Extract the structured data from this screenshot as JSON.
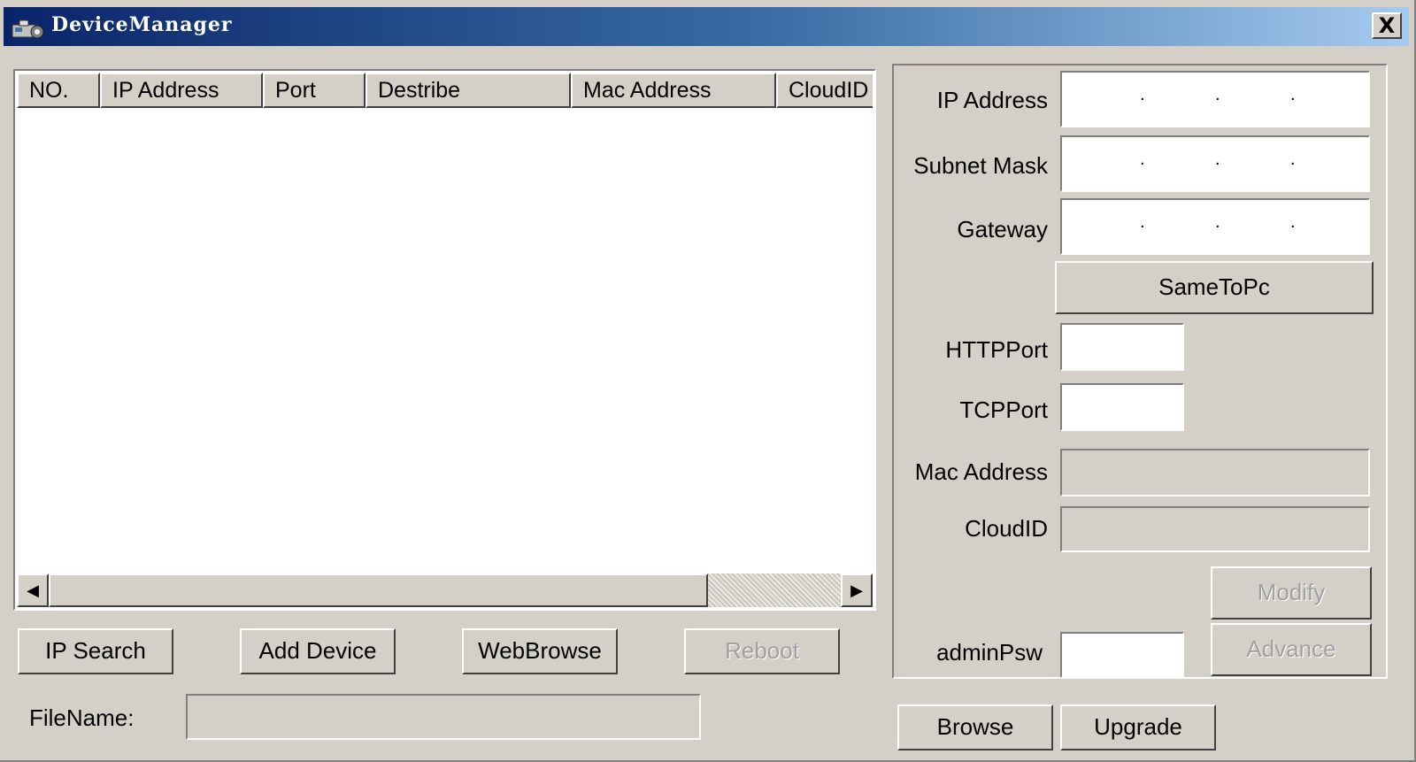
{
  "window": {
    "title": "DeviceManager",
    "close_glyph": "X",
    "app_icon": "device-manager-icon"
  },
  "list": {
    "columns": [
      "NO.",
      "IP Address",
      "Port",
      "Destribe",
      "Mac Address",
      "CloudID"
    ],
    "rows": []
  },
  "scrollbar": {
    "left_glyph": "◀",
    "right_glyph": "▶"
  },
  "actions": {
    "ip_search": "IP Search",
    "add_device": "Add Device",
    "web_browse": "WebBrowse",
    "reboot": "Reboot"
  },
  "file": {
    "label": "FileName:",
    "value": ""
  },
  "panel": {
    "ip_address_label": "IP Address",
    "ip_address_value": "",
    "subnet_mask_label": "Subnet Mask",
    "subnet_mask_value": "",
    "gateway_label": "Gateway",
    "gateway_value": "",
    "ip_separator": ".",
    "same_to_pc": "SameToPc",
    "http_port_label": "HTTPPort",
    "http_port_value": "",
    "tcp_port_label": "TCPPort",
    "tcp_port_value": "",
    "mac_address_label": "Mac Address",
    "mac_address_value": "",
    "cloud_id_label": "CloudID",
    "cloud_id_value": "",
    "modify": "Modify",
    "advance": "Advance",
    "admin_psw_label": "adminPsw",
    "admin_psw_value": ""
  },
  "bottom": {
    "browse": "Browse",
    "upgrade": "Upgrade"
  },
  "colors": {
    "face": "#d4d0c8",
    "title_gradient_start": "#0a246a",
    "title_gradient_end": "#a6caf0",
    "disabled_text": "#a0a0a0"
  }
}
